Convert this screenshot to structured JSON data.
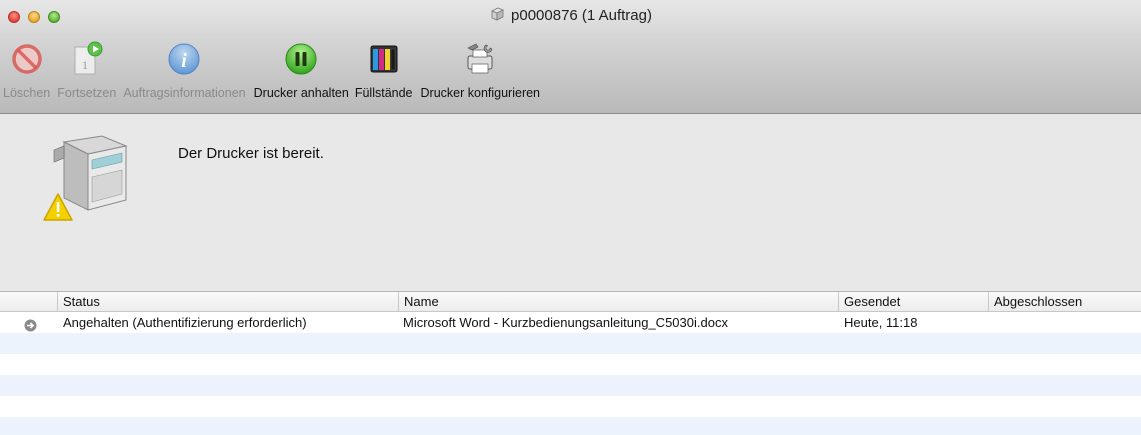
{
  "window": {
    "title": "p0000876 (1 Auftrag)"
  },
  "toolbar": {
    "items": [
      {
        "label": "Löschen",
        "icon": "delete-icon",
        "enabled": false
      },
      {
        "label": "Fortsetzen",
        "icon": "resume-icon",
        "enabled": false
      },
      {
        "label": "Auftragsinformationen",
        "icon": "info-icon",
        "enabled": false
      },
      {
        "label": "Drucker anhalten",
        "icon": "pause-icon",
        "enabled": true
      },
      {
        "label": "Füllstände",
        "icon": "ink-levels-icon",
        "enabled": true
      },
      {
        "label": "Drucker konfigurieren",
        "icon": "printer-setup-icon",
        "enabled": true
      }
    ]
  },
  "status": {
    "message": "Der Drucker ist bereit.",
    "icon": "printer-warning-icon"
  },
  "jobs": {
    "columns": [
      "Status",
      "Name",
      "Gesendet",
      "Abgeschlossen"
    ],
    "rows": [
      {
        "icon": "job-arrow-icon",
        "status": "Angehalten (Authentifizierung erforderlich)",
        "name": "Microsoft Word - Kurzbedienungsanleitung_C5030i.docx",
        "sent": "Heute, 11:18",
        "completed": ""
      }
    ]
  },
  "colors": {
    "alt_row": "#edf3fd",
    "pause_green": "#3fbf2a",
    "info_blue": "#4a8fd8",
    "delete_red": "#d9534f"
  }
}
